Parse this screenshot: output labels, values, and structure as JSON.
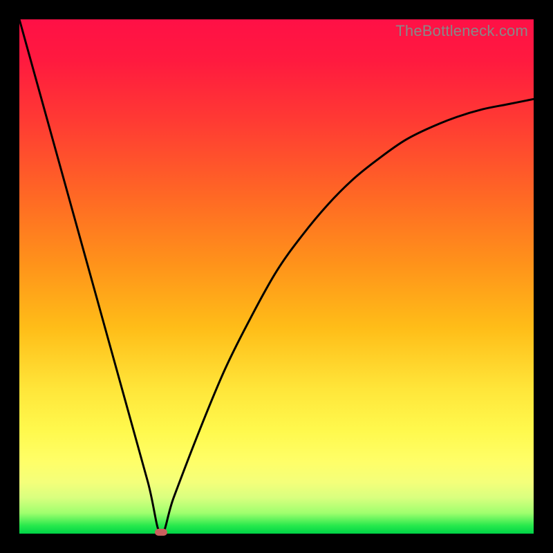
{
  "watermark": "TheBottleneck.com",
  "chart_data": {
    "type": "line",
    "title": "",
    "xlabel": "",
    "ylabel": "",
    "xlim": [
      0,
      100
    ],
    "ylim": [
      0,
      100
    ],
    "grid": false,
    "legend": false,
    "series": [
      {
        "name": "bottleneck-curve",
        "x": [
          0,
          5,
          10,
          15,
          20,
          25,
          27.5,
          30,
          35,
          40,
          45,
          50,
          55,
          60,
          65,
          70,
          75,
          80,
          85,
          90,
          95,
          100
        ],
        "values": [
          100,
          82,
          64,
          46,
          28,
          10,
          0,
          7,
          20,
          32,
          42,
          51,
          58,
          64,
          69,
          73,
          76.5,
          79,
          81,
          82.5,
          83.5,
          84.5
        ]
      }
    ],
    "min_marker": {
      "x": 27.5,
      "y": 0
    },
    "background_gradient": {
      "type": "vertical",
      "stops": [
        {
          "pct": 0,
          "color": "#ff1046"
        },
        {
          "pct": 35,
          "color": "#ff6a24"
        },
        {
          "pct": 72,
          "color": "#ffe63a"
        },
        {
          "pct": 90,
          "color": "#f4ff7a"
        },
        {
          "pct": 100,
          "color": "#00d447"
        }
      ]
    }
  },
  "colors": {
    "curve": "#000000",
    "marker": "#c9605e",
    "frame": "#000000"
  }
}
